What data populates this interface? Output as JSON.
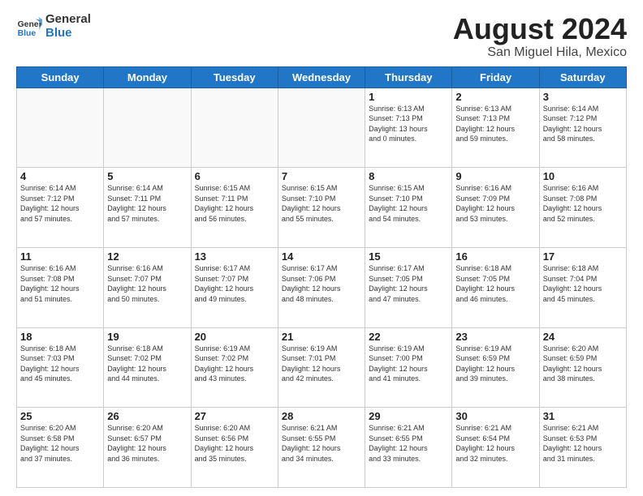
{
  "logo": {
    "line1": "General",
    "line2": "Blue"
  },
  "title": "August 2024",
  "location": "San Miguel Hila, Mexico",
  "weekdays": [
    "Sunday",
    "Monday",
    "Tuesday",
    "Wednesday",
    "Thursday",
    "Friday",
    "Saturday"
  ],
  "weeks": [
    [
      {
        "day": "",
        "info": ""
      },
      {
        "day": "",
        "info": ""
      },
      {
        "day": "",
        "info": ""
      },
      {
        "day": "",
        "info": ""
      },
      {
        "day": "1",
        "info": "Sunrise: 6:13 AM\nSunset: 7:13 PM\nDaylight: 13 hours\nand 0 minutes."
      },
      {
        "day": "2",
        "info": "Sunrise: 6:13 AM\nSunset: 7:13 PM\nDaylight: 12 hours\nand 59 minutes."
      },
      {
        "day": "3",
        "info": "Sunrise: 6:14 AM\nSunset: 7:12 PM\nDaylight: 12 hours\nand 58 minutes."
      }
    ],
    [
      {
        "day": "4",
        "info": "Sunrise: 6:14 AM\nSunset: 7:12 PM\nDaylight: 12 hours\nand 57 minutes."
      },
      {
        "day": "5",
        "info": "Sunrise: 6:14 AM\nSunset: 7:11 PM\nDaylight: 12 hours\nand 57 minutes."
      },
      {
        "day": "6",
        "info": "Sunrise: 6:15 AM\nSunset: 7:11 PM\nDaylight: 12 hours\nand 56 minutes."
      },
      {
        "day": "7",
        "info": "Sunrise: 6:15 AM\nSunset: 7:10 PM\nDaylight: 12 hours\nand 55 minutes."
      },
      {
        "day": "8",
        "info": "Sunrise: 6:15 AM\nSunset: 7:10 PM\nDaylight: 12 hours\nand 54 minutes."
      },
      {
        "day": "9",
        "info": "Sunrise: 6:16 AM\nSunset: 7:09 PM\nDaylight: 12 hours\nand 53 minutes."
      },
      {
        "day": "10",
        "info": "Sunrise: 6:16 AM\nSunset: 7:08 PM\nDaylight: 12 hours\nand 52 minutes."
      }
    ],
    [
      {
        "day": "11",
        "info": "Sunrise: 6:16 AM\nSunset: 7:08 PM\nDaylight: 12 hours\nand 51 minutes."
      },
      {
        "day": "12",
        "info": "Sunrise: 6:16 AM\nSunset: 7:07 PM\nDaylight: 12 hours\nand 50 minutes."
      },
      {
        "day": "13",
        "info": "Sunrise: 6:17 AM\nSunset: 7:07 PM\nDaylight: 12 hours\nand 49 minutes."
      },
      {
        "day": "14",
        "info": "Sunrise: 6:17 AM\nSunset: 7:06 PM\nDaylight: 12 hours\nand 48 minutes."
      },
      {
        "day": "15",
        "info": "Sunrise: 6:17 AM\nSunset: 7:05 PM\nDaylight: 12 hours\nand 47 minutes."
      },
      {
        "day": "16",
        "info": "Sunrise: 6:18 AM\nSunset: 7:05 PM\nDaylight: 12 hours\nand 46 minutes."
      },
      {
        "day": "17",
        "info": "Sunrise: 6:18 AM\nSunset: 7:04 PM\nDaylight: 12 hours\nand 45 minutes."
      }
    ],
    [
      {
        "day": "18",
        "info": "Sunrise: 6:18 AM\nSunset: 7:03 PM\nDaylight: 12 hours\nand 45 minutes."
      },
      {
        "day": "19",
        "info": "Sunrise: 6:18 AM\nSunset: 7:02 PM\nDaylight: 12 hours\nand 44 minutes."
      },
      {
        "day": "20",
        "info": "Sunrise: 6:19 AM\nSunset: 7:02 PM\nDaylight: 12 hours\nand 43 minutes."
      },
      {
        "day": "21",
        "info": "Sunrise: 6:19 AM\nSunset: 7:01 PM\nDaylight: 12 hours\nand 42 minutes."
      },
      {
        "day": "22",
        "info": "Sunrise: 6:19 AM\nSunset: 7:00 PM\nDaylight: 12 hours\nand 41 minutes."
      },
      {
        "day": "23",
        "info": "Sunrise: 6:19 AM\nSunset: 6:59 PM\nDaylight: 12 hours\nand 39 minutes."
      },
      {
        "day": "24",
        "info": "Sunrise: 6:20 AM\nSunset: 6:59 PM\nDaylight: 12 hours\nand 38 minutes."
      }
    ],
    [
      {
        "day": "25",
        "info": "Sunrise: 6:20 AM\nSunset: 6:58 PM\nDaylight: 12 hours\nand 37 minutes."
      },
      {
        "day": "26",
        "info": "Sunrise: 6:20 AM\nSunset: 6:57 PM\nDaylight: 12 hours\nand 36 minutes."
      },
      {
        "day": "27",
        "info": "Sunrise: 6:20 AM\nSunset: 6:56 PM\nDaylight: 12 hours\nand 35 minutes."
      },
      {
        "day": "28",
        "info": "Sunrise: 6:21 AM\nSunset: 6:55 PM\nDaylight: 12 hours\nand 34 minutes."
      },
      {
        "day": "29",
        "info": "Sunrise: 6:21 AM\nSunset: 6:55 PM\nDaylight: 12 hours\nand 33 minutes."
      },
      {
        "day": "30",
        "info": "Sunrise: 6:21 AM\nSunset: 6:54 PM\nDaylight: 12 hours\nand 32 minutes."
      },
      {
        "day": "31",
        "info": "Sunrise: 6:21 AM\nSunset: 6:53 PM\nDaylight: 12 hours\nand 31 minutes."
      }
    ]
  ]
}
